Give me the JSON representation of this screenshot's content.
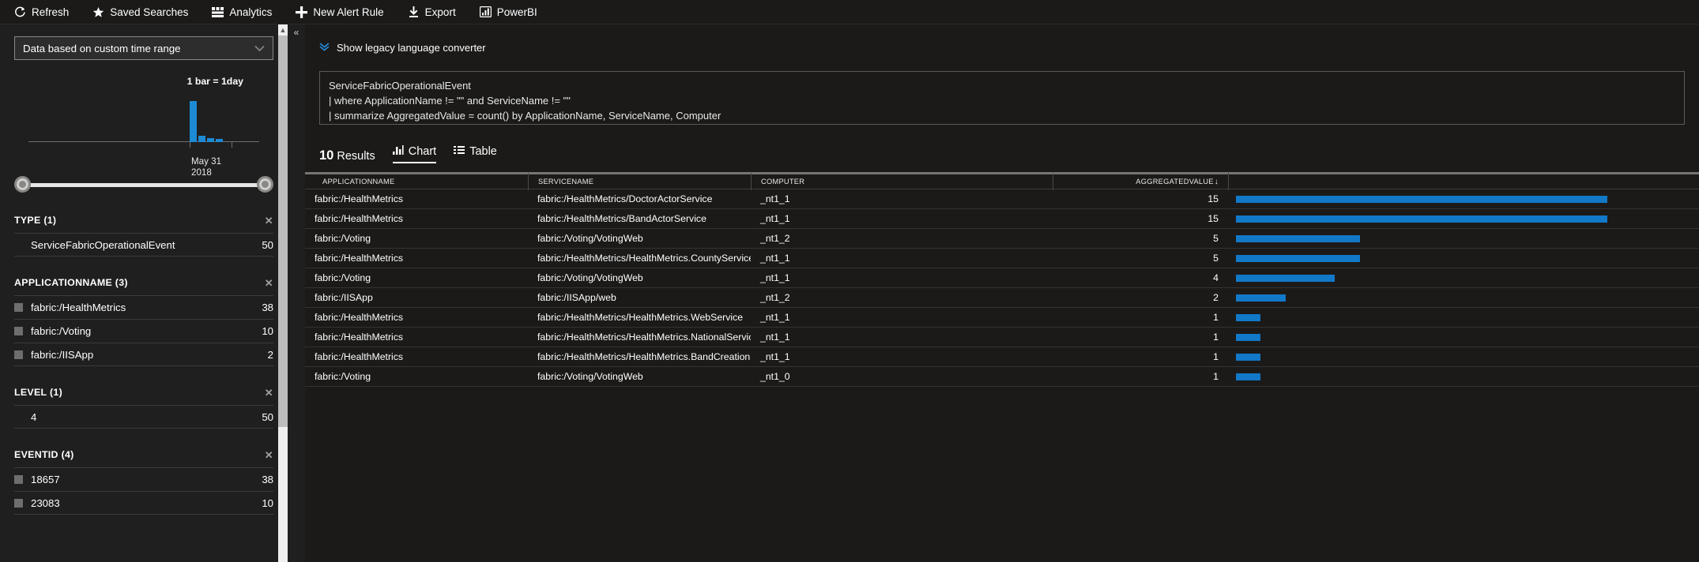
{
  "toolbar": {
    "items": [
      {
        "label": "Refresh",
        "icon": "refresh-icon"
      },
      {
        "label": "Saved Searches",
        "icon": "star-icon"
      },
      {
        "label": "Analytics",
        "icon": "analytics-icon"
      },
      {
        "label": "New Alert Rule",
        "icon": "plus-icon"
      },
      {
        "label": "Export",
        "icon": "download-icon"
      },
      {
        "label": "PowerBI",
        "icon": "powerbi-icon"
      }
    ]
  },
  "left": {
    "time_range": {
      "value": "Data based on custom time range",
      "chevron": "chevron-down-icon"
    },
    "histogram": {
      "bar_legend": "1 bar = 1day",
      "axis_label": "May 31\n2018"
    },
    "facets": [
      {
        "title": "TYPE",
        "count_label": "(1)",
        "has_checkbox": false,
        "rows": [
          {
            "label": "ServiceFabricOperationalEvent",
            "count": "50"
          }
        ]
      },
      {
        "title": "APPLICATIONNAME",
        "count_label": "(3)",
        "has_checkbox": true,
        "rows": [
          {
            "label": "fabric:/HealthMetrics",
            "count": "38"
          },
          {
            "label": "fabric:/Voting",
            "count": "10"
          },
          {
            "label": "fabric:/IISApp",
            "count": "2"
          }
        ]
      },
      {
        "title": "LEVEL",
        "count_label": "(1)",
        "has_checkbox": false,
        "rows": [
          {
            "label": "4",
            "count": "50"
          }
        ]
      },
      {
        "title": "EVENTID",
        "count_label": "(4)",
        "has_checkbox": true,
        "rows": [
          {
            "label": "18657",
            "count": "38"
          },
          {
            "label": "23083",
            "count": "10"
          }
        ]
      }
    ]
  },
  "right": {
    "legacy_link": "Show legacy language converter",
    "query_lines": [
      "ServiceFabricOperationalEvent",
      "| where ApplicationName != \"\" and ServiceName != \"\"",
      "| summarize AggregatedValue = count() by ApplicationName, ServiceName, Computer"
    ],
    "results": {
      "count": "10",
      "count_word": "Results",
      "tabs": [
        {
          "label": "Chart",
          "icon": "bar-chart-icon",
          "active": true
        },
        {
          "label": "Table",
          "icon": "list-icon",
          "active": false
        }
      ]
    }
  },
  "chart_data": {
    "type": "bar",
    "title": "",
    "xlabel": "",
    "ylabel": "",
    "orientation": "horizontal",
    "columns": [
      "APPLICATIONNAME",
      "SERVICENAME",
      "COMPUTER",
      "AGGREGATEDVALUE"
    ],
    "sort_column": "AGGREGATEDVALUE",
    "sort_direction": "desc",
    "sort_arrow_glyph": "↓",
    "max_value": 15,
    "rows": [
      {
        "application": "fabric:/HealthMetrics",
        "service": "fabric:/HealthMetrics/DoctorActorService",
        "computer": "_nt1_1",
        "value": 15
      },
      {
        "application": "fabric:/HealthMetrics",
        "service": "fabric:/HealthMetrics/BandActorService",
        "computer": "_nt1_1",
        "value": 15
      },
      {
        "application": "fabric:/Voting",
        "service": "fabric:/Voting/VotingWeb",
        "computer": "_nt1_2",
        "value": 5
      },
      {
        "application": "fabric:/HealthMetrics",
        "service": "fabric:/HealthMetrics/HealthMetrics.CountyService",
        "computer": "_nt1_1",
        "value": 5
      },
      {
        "application": "fabric:/Voting",
        "service": "fabric:/Voting/VotingWeb",
        "computer": "_nt1_1",
        "value": 4
      },
      {
        "application": "fabric:/IISApp",
        "service": "fabric:/IISApp/web",
        "computer": "_nt1_2",
        "value": 2
      },
      {
        "application": "fabric:/HealthMetrics",
        "service": "fabric:/HealthMetrics/HealthMetrics.WebService",
        "computer": "_nt1_1",
        "value": 1
      },
      {
        "application": "fabric:/HealthMetrics",
        "service": "fabric:/HealthMetrics/HealthMetrics.NationalService",
        "computer": "_nt1_1",
        "value": 1
      },
      {
        "application": "fabric:/HealthMetrics",
        "service": "fabric:/HealthMetrics/HealthMetrics.BandCreationService",
        "computer": "_nt1_1",
        "value": 1
      },
      {
        "application": "fabric:/Voting",
        "service": "fabric:/Voting/VotingWeb",
        "computer": "_nt1_0",
        "value": 1
      }
    ],
    "timeline_histogram": {
      "type": "bar",
      "bar_width_label": "1 bar = 1day",
      "tick_label": "May 31 2018",
      "values": [
        50,
        11,
        5,
        4
      ]
    },
    "colors": {
      "bar": "#1278c8",
      "histogram_bar": "#1d8ad4",
      "accent": "#2489d8"
    }
  }
}
